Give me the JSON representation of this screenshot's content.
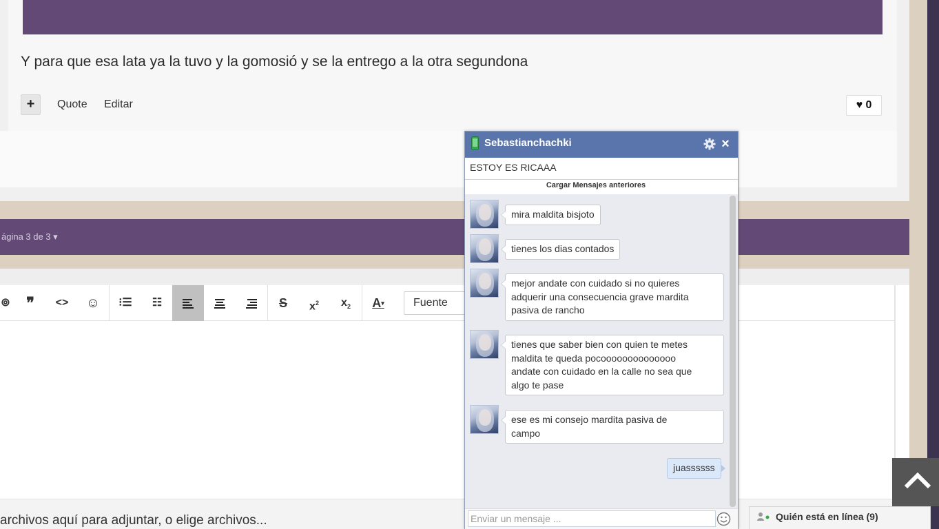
{
  "post": {
    "text": "Y para que esa lata ya la tuvo y la gomosió y se la entrego a la otra segundona",
    "plus_label": "+",
    "quote_label": "Quote",
    "edit_label": "Editar",
    "like_count": "0",
    "like_icon": "heart-icon"
  },
  "pagination": {
    "label": "ágina 3 de 3 ▾"
  },
  "editor": {
    "toolbar": {
      "buttons": [
        {
          "name": "link-icon",
          "glyph": "⊚"
        },
        {
          "name": "quote-icon",
          "glyph": "❞"
        },
        {
          "name": "code-icon",
          "glyph": "<>"
        },
        {
          "name": "smiley-icon",
          "glyph": "☺"
        },
        {
          "name": "bullet-list-icon",
          "glyph": "☰"
        },
        {
          "name": "numbered-list-icon",
          "glyph": "☷"
        },
        {
          "name": "align-left-icon",
          "glyph": "≡"
        },
        {
          "name": "align-center-icon",
          "glyph": "≡"
        },
        {
          "name": "align-right-icon",
          "glyph": "≡"
        },
        {
          "name": "strikethrough-icon",
          "glyph": "S"
        },
        {
          "name": "superscript-icon",
          "glyph": "x²"
        },
        {
          "name": "subscript-icon",
          "glyph": "x₂"
        },
        {
          "name": "text-color-icon",
          "glyph": "A"
        }
      ],
      "font_select": "Fuente"
    },
    "attach_text": "archivos aquí para adjuntar, o elige archivos..."
  },
  "chat": {
    "title": "Sebastianchachki",
    "status_message": "ESTOY ES RICAAA",
    "load_more": "Cargar Mensajes anteriores",
    "close_glyph": "×",
    "input_placeholder": "Enviar un mensaje ...",
    "messages": [
      {
        "from": "other",
        "lines": [
          "mira maldita bisjoto"
        ]
      },
      {
        "from": "other",
        "lines": [
          "tienes los dias contados"
        ]
      },
      {
        "from": "other",
        "lines": [
          "mejor andate con cuidado si no quieres",
          "adquerir una consecuencia grave mardita",
          "pasiva de rancho"
        ]
      },
      {
        "from": "other",
        "lines": [
          "tienes que saber bien con quien te metes",
          "maldita te queda pocoooooooooooooo",
          "andate  con cuidado en la calle no sea que",
          "algo te pase"
        ]
      },
      {
        "from": "other",
        "lines": [
          "ese es  mi consejo mardita pasiva de",
          "campo"
        ]
      },
      {
        "from": "me",
        "lines": [
          "juassssss"
        ]
      }
    ]
  },
  "online": {
    "label": "Quién está en línea (9)"
  },
  "colors": {
    "purple": "#634a76",
    "tan": "#dcd0c0",
    "chat_header": "#5a74ac",
    "chat_bg": "#e9ebf0"
  }
}
